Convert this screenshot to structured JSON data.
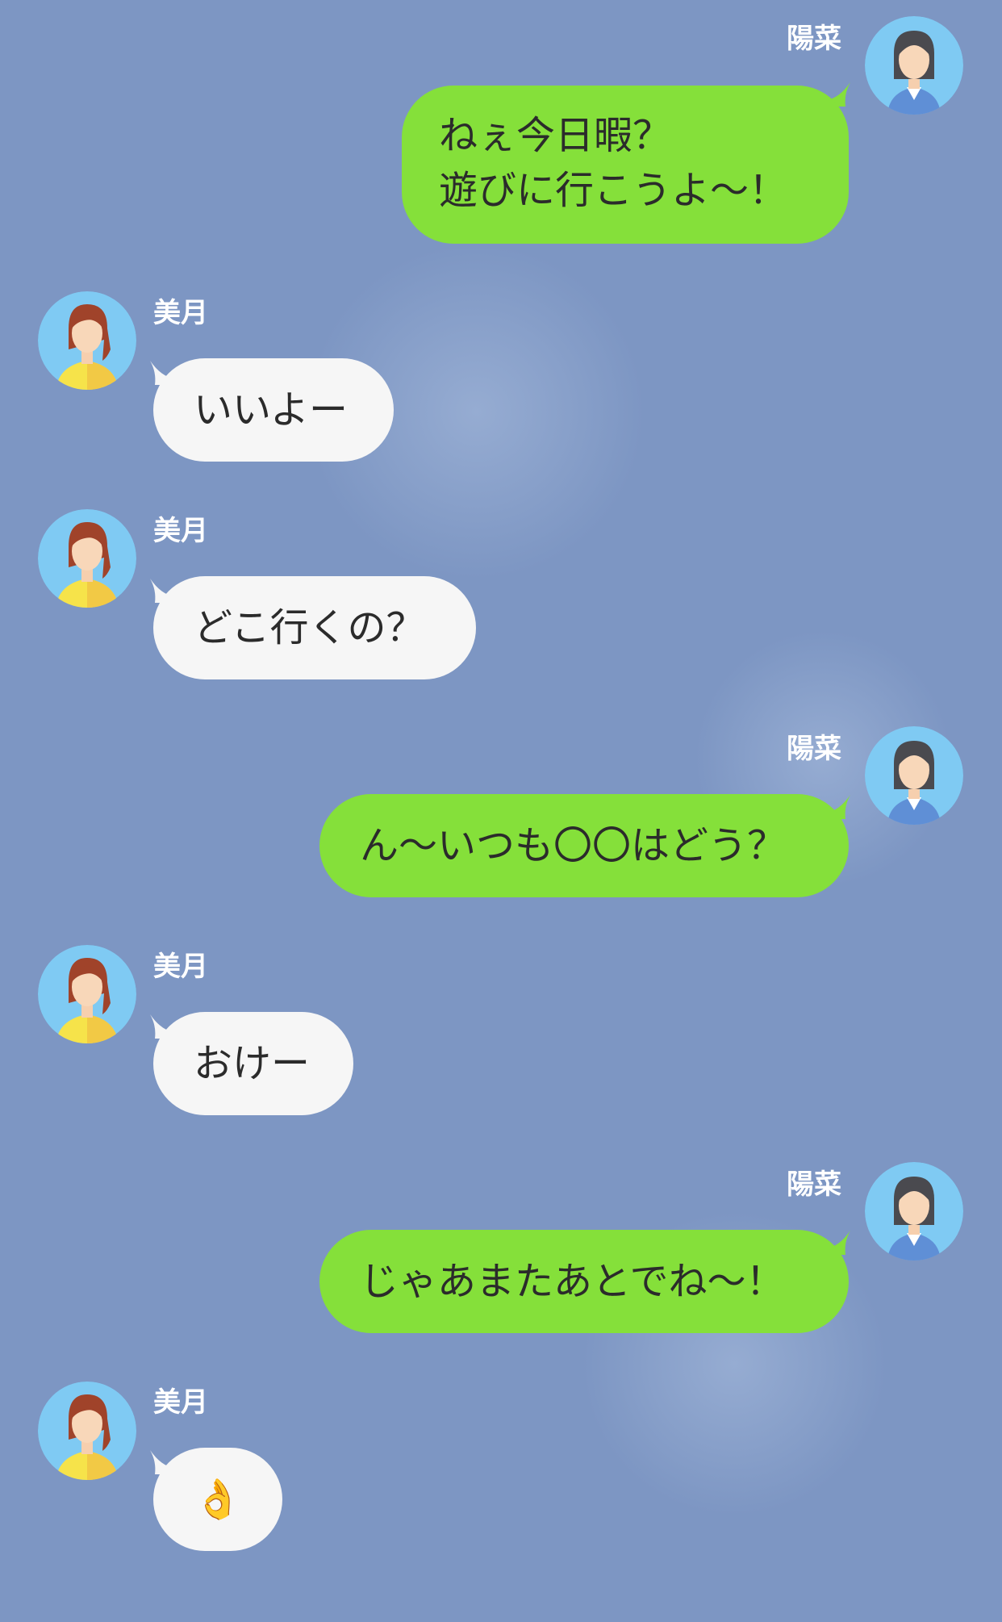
{
  "participants": {
    "self": {
      "name": "陽菜",
      "avatar_icon": "woman-dark-hair-avatar-icon"
    },
    "other": {
      "name": "美月",
      "avatar_icon": "woman-brown-ponytail-avatar-icon"
    }
  },
  "colors": {
    "background": "#7d96c3",
    "outgoing_bubble": "#85e03a",
    "incoming_bubble": "#f6f6f6",
    "name_text": "#ffffff"
  },
  "messages": [
    {
      "sender": "陽菜",
      "text": "ねぇ今日暇？\n遊びに行こうよ〜！"
    },
    {
      "sender": "美月",
      "text": "いいよー"
    },
    {
      "sender": "美月",
      "text": "どこ行くの？"
    },
    {
      "sender": "陽菜",
      "text": "ん〜いつも〇〇はどう？"
    },
    {
      "sender": "美月",
      "text": "おけー"
    },
    {
      "sender": "陽菜",
      "text": "じゃあまたあとでね〜！"
    },
    {
      "sender": "美月",
      "text": "👌",
      "icon": "ok-hand-emoji-icon"
    }
  ]
}
